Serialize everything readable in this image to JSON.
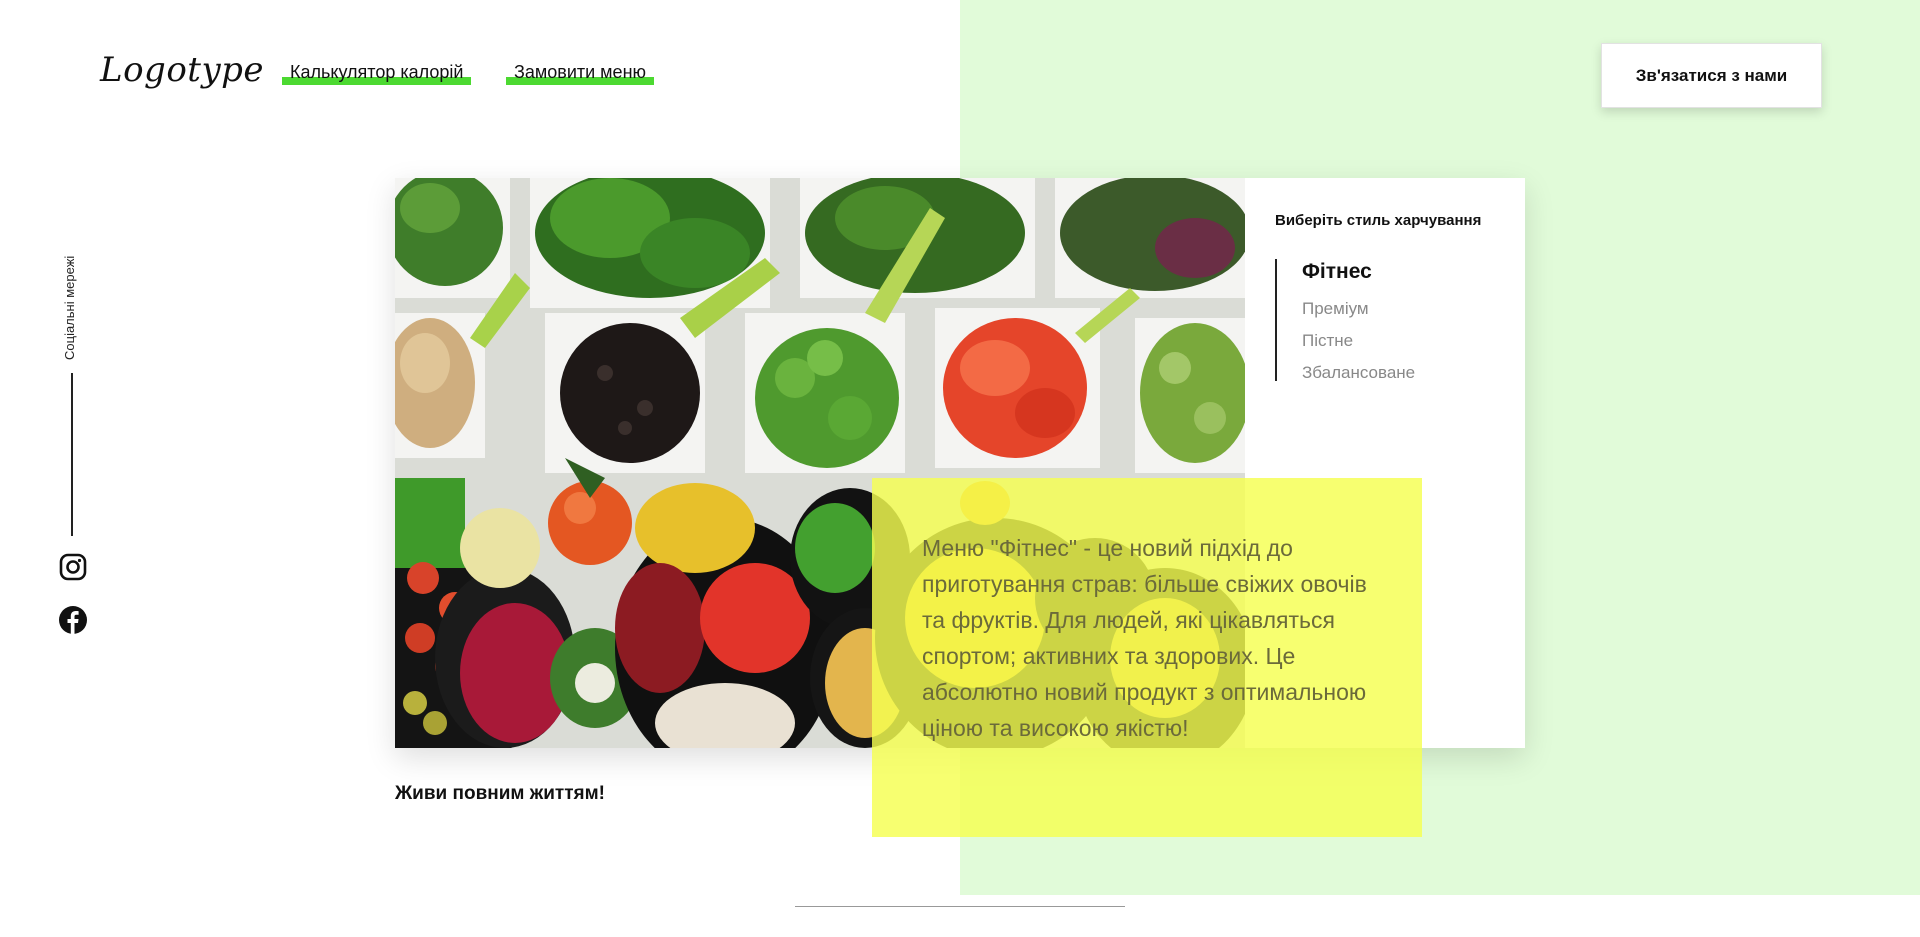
{
  "header": {
    "logo": "Logotype",
    "nav": [
      {
        "label": "Калькулятор калорій"
      },
      {
        "label": "Замовити меню"
      }
    ],
    "contact_button": "Зв'язатися з нами"
  },
  "social": {
    "label": "Соціальні мережі",
    "icons": [
      "instagram-icon",
      "facebook-icon"
    ]
  },
  "hero": {
    "image_alt": "Assorted fresh vegetables in bowls",
    "style_title": "Виберіть стиль харчування",
    "styles": [
      "Фітнес",
      "Преміум",
      "Пістне",
      "Збалансоване"
    ],
    "active_style": "Фітнес",
    "description": "Меню \"Фітнес\" - це новий підхід до приготування страв: більше свіжих овочів та фруктів. Для людей, які цікавляться спортом; активних та здорових. Це абсолютно новий продукт з оптимальною ціною та високою якістю!",
    "tagline": "Живи повним життям!"
  },
  "colors": {
    "accent_green": "#4cd931",
    "light_green_bg": "#e1fbd9",
    "yellow_overlay": "#f5ff50"
  }
}
